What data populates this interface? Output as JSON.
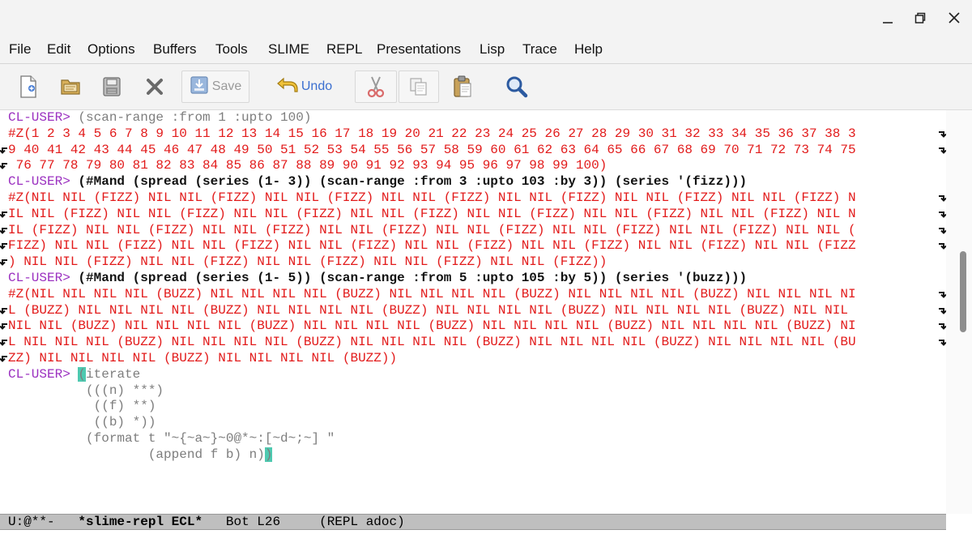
{
  "window": {
    "controls": [
      "minimize-icon",
      "maximize-icon",
      "close-icon"
    ]
  },
  "menubar": {
    "items": [
      "File",
      "Edit",
      "Options",
      "Buffers",
      "Tools",
      "SLIME",
      "REPL",
      "Presentations",
      "Lisp",
      "Trace",
      "Help"
    ]
  },
  "toolbar": {
    "save_label": "Save",
    "undo_label": "Undo",
    "icons": [
      "new-file-icon",
      "open-folder-icon",
      "save-file-icon",
      "close-buffer-icon",
      "save-icon",
      "undo-icon",
      "cut-icon",
      "copy-icon",
      "paste-icon",
      "search-icon"
    ]
  },
  "repl": {
    "prompt": "CL-USER>",
    "lines": [
      {
        "prompt": "CL-USER>",
        "input": " (scan-range :from 1 :upto 100)"
      },
      {
        "result": "#Z(1 2 3 4 5 6 7 8 9 10 11 12 13 14 15 16 17 18 19 20 21 22 23 24 25 26 27 28 29 30 31 32 33 34 35 36 37 38 3",
        "cont": "right"
      },
      {
        "result": "9 40 41 42 43 44 45 46 47 48 49 50 51 52 53 54 55 56 57 58 59 60 61 62 63 64 65 66 67 68 69 70 71 72 73 74 75",
        "cont": "both"
      },
      {
        "result": " 76 77 78 79 80 81 82 83 84 85 86 87 88 89 90 91 92 93 94 95 96 97 98 99 100)",
        "cont": "left"
      },
      {
        "prompt": "CL-USER>",
        "input_bold": " (#Mand (spread (series (1- 3)) (scan-range :from 3 :upto 103 :by 3)) (series '(fizz)))"
      },
      {
        "result": "#Z(NIL NIL (FIZZ) NIL NIL (FIZZ) NIL NIL (FIZZ) NIL NIL (FIZZ) NIL NIL (FIZZ) NIL NIL (FIZZ) NIL NIL (FIZZ) N",
        "cont": "right"
      },
      {
        "result": "IL NIL (FIZZ) NIL NIL (FIZZ) NIL NIL (FIZZ) NIL NIL (FIZZ) NIL NIL (FIZZ) NIL NIL (FIZZ) NIL NIL (FIZZ) NIL N",
        "cont": "both"
      },
      {
        "result": "IL (FIZZ) NIL NIL (FIZZ) NIL NIL (FIZZ) NIL NIL (FIZZ) NIL NIL (FIZZ) NIL NIL (FIZZ) NIL NIL (FIZZ) NIL NIL (",
        "cont": "both"
      },
      {
        "result": "FIZZ) NIL NIL (FIZZ) NIL NIL (FIZZ) NIL NIL (FIZZ) NIL NIL (FIZZ) NIL NIL (FIZZ) NIL NIL (FIZZ) NIL NIL (FIZZ",
        "cont": "both"
      },
      {
        "result": ") NIL NIL (FIZZ) NIL NIL (FIZZ) NIL NIL (FIZZ) NIL NIL (FIZZ) NIL NIL (FIZZ))",
        "cont": "left"
      },
      {
        "prompt": "CL-USER>",
        "input_bold": " (#Mand (spread (series (1- 5)) (scan-range :from 5 :upto 105 :by 5)) (series '(buzz)))"
      },
      {
        "result": "#Z(NIL NIL NIL NIL (BUZZ) NIL NIL NIL NIL (BUZZ) NIL NIL NIL NIL (BUZZ) NIL NIL NIL NIL (BUZZ) NIL NIL NIL NI",
        "cont": "right"
      },
      {
        "result": "L (BUZZ) NIL NIL NIL NIL (BUZZ) NIL NIL NIL NIL (BUZZ) NIL NIL NIL NIL (BUZZ) NIL NIL NIL NIL (BUZZ) NIL NIL ",
        "cont": "both"
      },
      {
        "result": "NIL NIL (BUZZ) NIL NIL NIL NIL (BUZZ) NIL NIL NIL NIL (BUZZ) NIL NIL NIL NIL (BUZZ) NIL NIL NIL NIL (BUZZ) NI",
        "cont": "both"
      },
      {
        "result": "L NIL NIL NIL (BUZZ) NIL NIL NIL NIL (BUZZ) NIL NIL NIL NIL (BUZZ) NIL NIL NIL NIL (BUZZ) NIL NIL NIL NIL (BU",
        "cont": "both"
      },
      {
        "result": "ZZ) NIL NIL NIL NIL (BUZZ) NIL NIL NIL NIL (BUZZ))",
        "cont": "left"
      },
      {
        "prompt": "CL-USER>",
        "pre": " ",
        "cursor_char": "(",
        "input": "iterate"
      },
      {
        "input": "          (((n) ***)"
      },
      {
        "input": "           ((f) **)"
      },
      {
        "input": "           ((b) *))"
      },
      {
        "input": "          (format t \"~{~a~}~0@*~:[~d~;~] \""
      },
      {
        "input": "                  (append f b) n)",
        "cursor_after": ")"
      }
    ]
  },
  "modeline": {
    "status": "U:@**-",
    "buffer": "*slime-repl ECL*",
    "position": "Bot L26",
    "modes": "(REPL adoc)"
  },
  "colors": {
    "prompt": "#9b30c0",
    "result": "#e21b1b",
    "input": "#7d7d7d",
    "cursor": "#4ec9b0",
    "modeline_bg": "#bfbfbf"
  }
}
